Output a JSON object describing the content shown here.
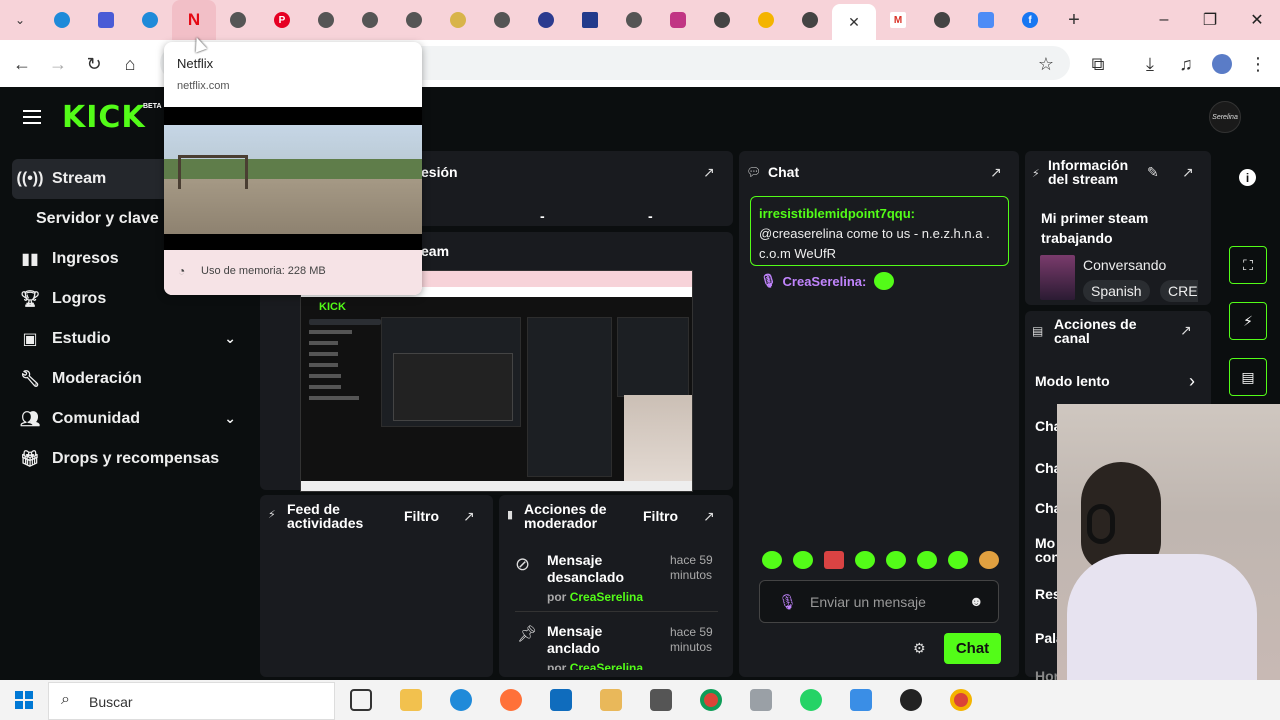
{
  "tooltip": {
    "title": "Netflix",
    "url": "netflix.com",
    "memory": "Uso de memoria: 228 MB"
  },
  "sidebar": {
    "items": [
      {
        "label": "Stream"
      },
      {
        "label": "Servidor y clave"
      },
      {
        "label": "Ingresos"
      },
      {
        "label": "Logros"
      },
      {
        "label": "Estudio"
      },
      {
        "label": "Moderación"
      },
      {
        "label": "Comunidad"
      },
      {
        "label": "Drops y recompensas"
      }
    ]
  },
  "panels": {
    "session_title_fragment": "esión",
    "session_dash1": "-",
    "session_dash2": "-",
    "preview_title_fragment": "eam",
    "feed_title": "Feed de actividades",
    "feed_filter": "Filtro",
    "mod_title": "Acciones de moderador",
    "mod_filter": "Filtro"
  },
  "mod_actions": [
    {
      "action": "Mensaje desanclado",
      "by_prefix": "por",
      "user": "CreaSerelina",
      "time": "hace 59 minutos"
    },
    {
      "action": "Mensaje anclado",
      "by_prefix": "por",
      "user": "CreaSerelina",
      "time": "hace 59 minutos"
    }
  ],
  "chat": {
    "title": "Chat",
    "highlight_user": "irresistiblemidpoint7qqu:",
    "highlight_text": "@creaserelina come to us - n.e.z.h.n.a . c.o.m WeUfR",
    "msg_user": "CreaSerelina:",
    "input_placeholder": "Enviar un mensaje",
    "send_label": "Chat"
  },
  "stream_info": {
    "title": "Información del stream",
    "stream_title": "Mi primer steam trabajando",
    "category": "Conversando",
    "tag1": "Spanish",
    "tag2": "CRE"
  },
  "channel_actions": {
    "title": "Acciones de canal",
    "slow_mode": "Modo lento",
    "rows": [
      "Cha",
      "Cha",
      "Cha",
      "Mo con",
      "Res",
      "Pala",
      "Hor"
    ]
  },
  "taskbar": {
    "search_placeholder": "Buscar"
  },
  "colors": {
    "accent": "#53fc18",
    "panel": "#191b1f",
    "bg": "#0b0e0f",
    "tabstrip": "#f7d3d9"
  }
}
